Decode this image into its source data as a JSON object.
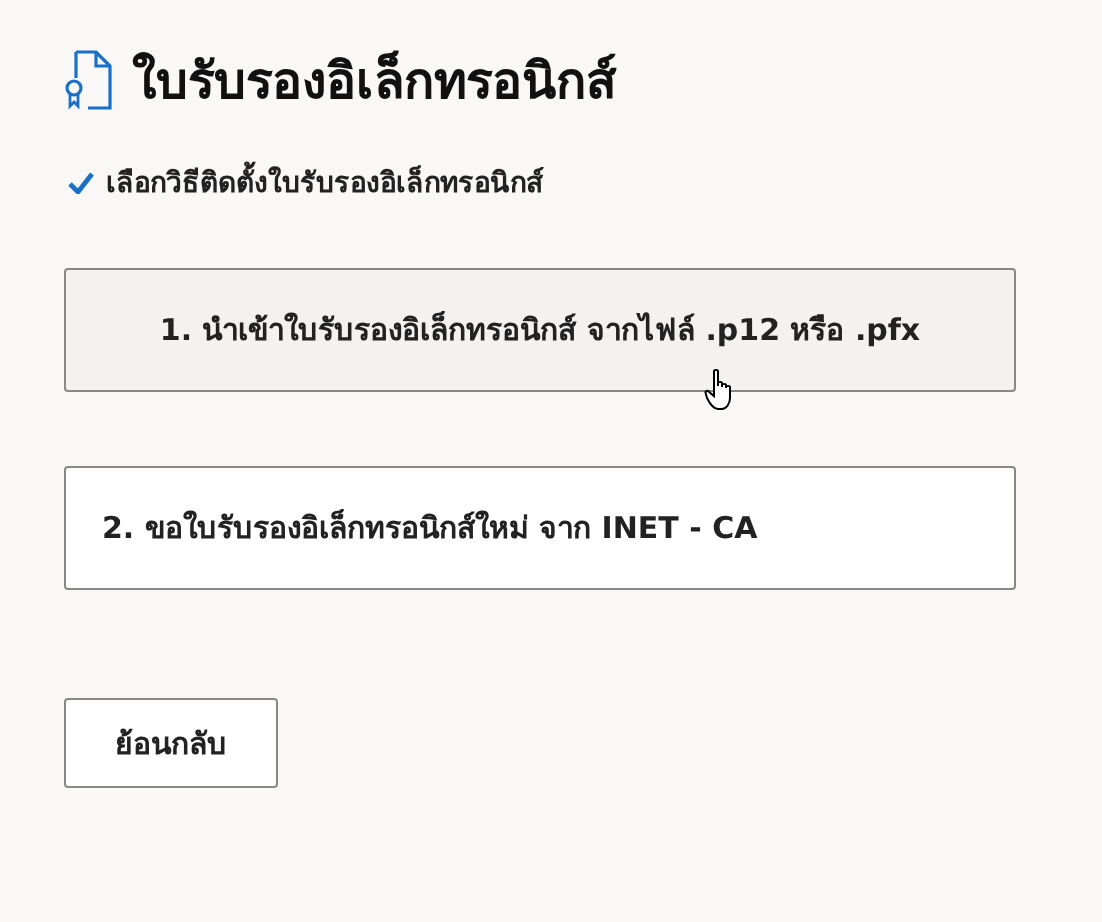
{
  "title": "ใบรับรองอิเล็กทรอนิกส์",
  "step": {
    "label": "เลือกวิธีติดตั้งใบรับรองอิเล็กทรอนิกส์",
    "checked": true
  },
  "options": [
    {
      "label": "1. นำเข้าใบรับรองอิเล็กทรอนิกส์ จากไฟล์ .p12 หรือ .pfx",
      "hovered": true
    },
    {
      "label": "2. ขอใบรับรองอิเล็กทรอนิกส์ใหม่ จาก INET - CA",
      "hovered": false
    }
  ],
  "back_button": "ย้อนกลับ"
}
